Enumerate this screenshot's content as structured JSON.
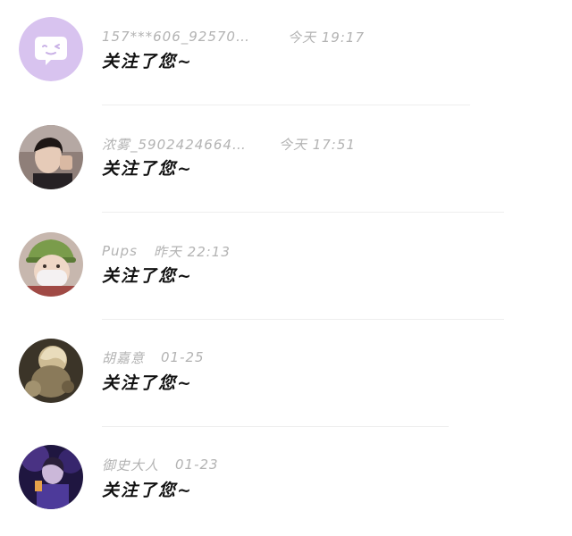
{
  "notifications": [
    {
      "username": "157***606_925705…",
      "time": "今天 19:17",
      "message": "关注了您~",
      "avatar_icon": "default-avatar-icon",
      "avatar_color": "#d8c2ee"
    },
    {
      "username": "浓雾_5902424664…",
      "time": "今天 17:51",
      "message": "关注了您~",
      "avatar_icon": "photo-avatar",
      "avatar_color": "#6a5a52"
    },
    {
      "username": "Pups",
      "time": "昨天 22:13",
      "message": "关注了您~",
      "avatar_icon": "photo-avatar",
      "avatar_color": "#8aa66b"
    },
    {
      "username": "胡嘉意",
      "time": "01-25",
      "message": "关注了您~",
      "avatar_icon": "photo-avatar",
      "avatar_color": "#8b7a5c"
    },
    {
      "username": "御史大人",
      "time": "01-23",
      "message": "关注了您~",
      "avatar_icon": "photo-avatar",
      "avatar_color": "#4a2f7a"
    }
  ]
}
